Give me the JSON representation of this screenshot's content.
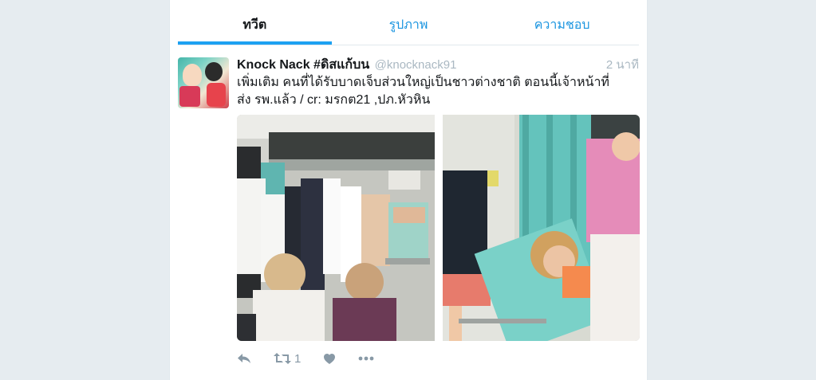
{
  "tabs": [
    {
      "label": "ทวีต",
      "active": true
    },
    {
      "label": "รูปภาพ",
      "active": false
    },
    {
      "label": "ความชอบ",
      "active": false
    }
  ],
  "tweet": {
    "fullname": "Knock Nack #ดิสแก้บน",
    "handle": "@knocknack91",
    "time": "2 นาที",
    "text": "เพิ่มเติม คนที่ได้รับบาดเจ็บส่วนใหญ่เป็นชาวต่างชาติ ตอนนี้เจ้าหน้าที่ส่ง รพ.แล้ว / cr: มรกต21 ,ปภ.หัวหิน",
    "retweet_count": "1"
  },
  "icons": {
    "reply": "reply-icon",
    "retweet": "retweet-icon",
    "like": "heart-icon",
    "more": "more-icon"
  },
  "colors": {
    "accent": "#1da1f2",
    "link": "#1b95e0",
    "muted": "#aab8c2",
    "action": "#8899a6",
    "background": "#e6ecf0"
  }
}
